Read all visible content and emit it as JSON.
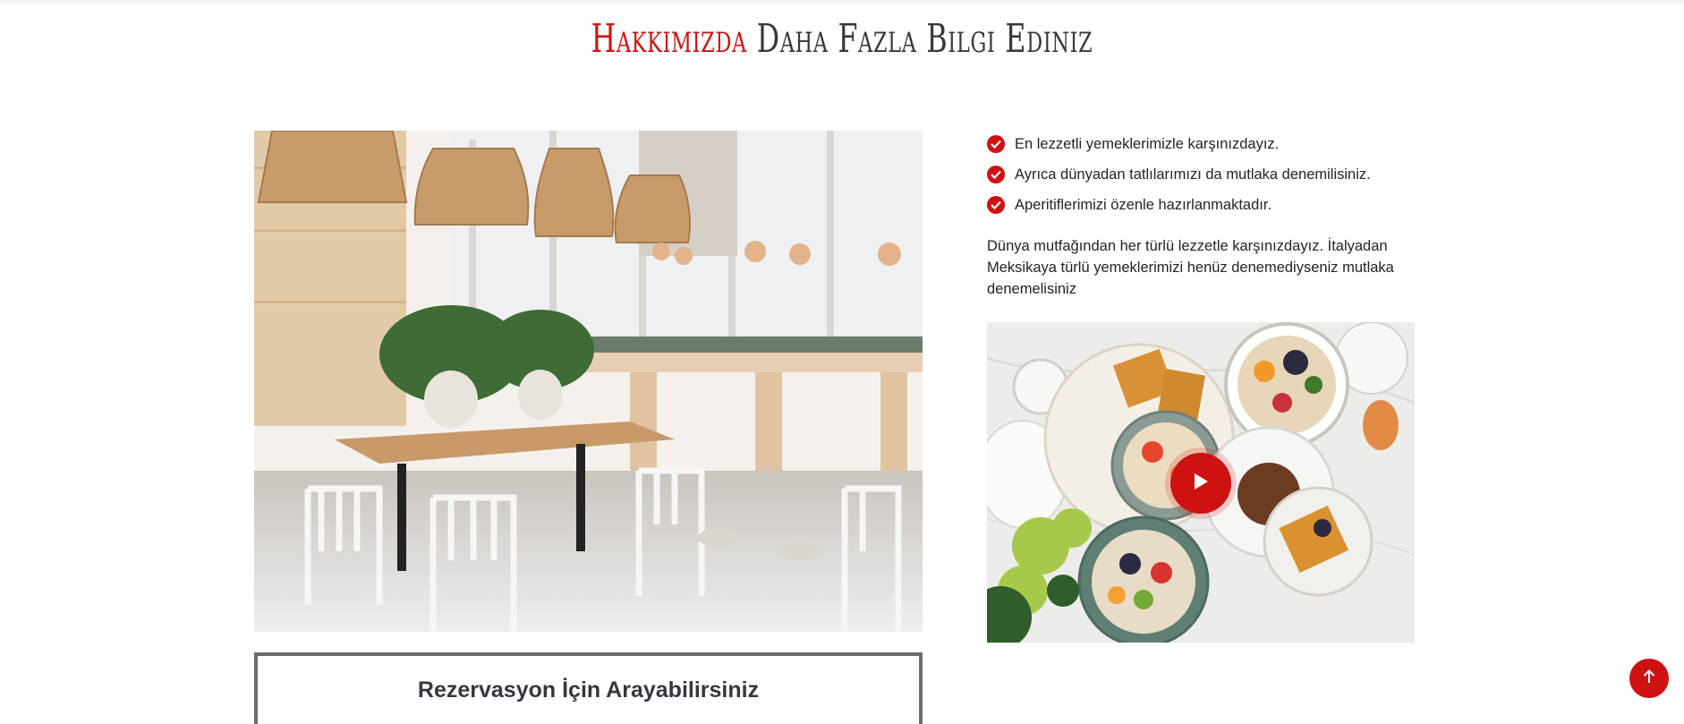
{
  "section": {
    "title_accent": "Hakkımızda",
    "title_rest": " Daha Fazla Bilgi Ediniz"
  },
  "features": [
    {
      "icon": "check-circle-icon",
      "text": "En lezzetli yemeklerimizle karşınızdayız."
    },
    {
      "icon": "check-circle-icon",
      "text": "Ayrıca dünyadan tatlılarımızı da mutlaka denemilisiniz."
    },
    {
      "icon": "check-circle-icon",
      "text": "Aperitiflerimizi özenle hazırlanmaktadır."
    }
  ],
  "description": "Dünya mutfağından her türlü lezzetle karşınızdayız. İtalyadan Meksikaya türlü yemeklerimizi henüz denemediyseniz mutlaka denemelisiniz",
  "call_box": {
    "heading": "Rezervasyon İçin Arayabilirsiniz"
  },
  "video": {
    "play_icon": "play-icon"
  },
  "scroll_top": {
    "icon": "arrow-up-icon"
  },
  "colors": {
    "accent": "#ce1212",
    "heading": "#37373f",
    "text": "#212529"
  }
}
